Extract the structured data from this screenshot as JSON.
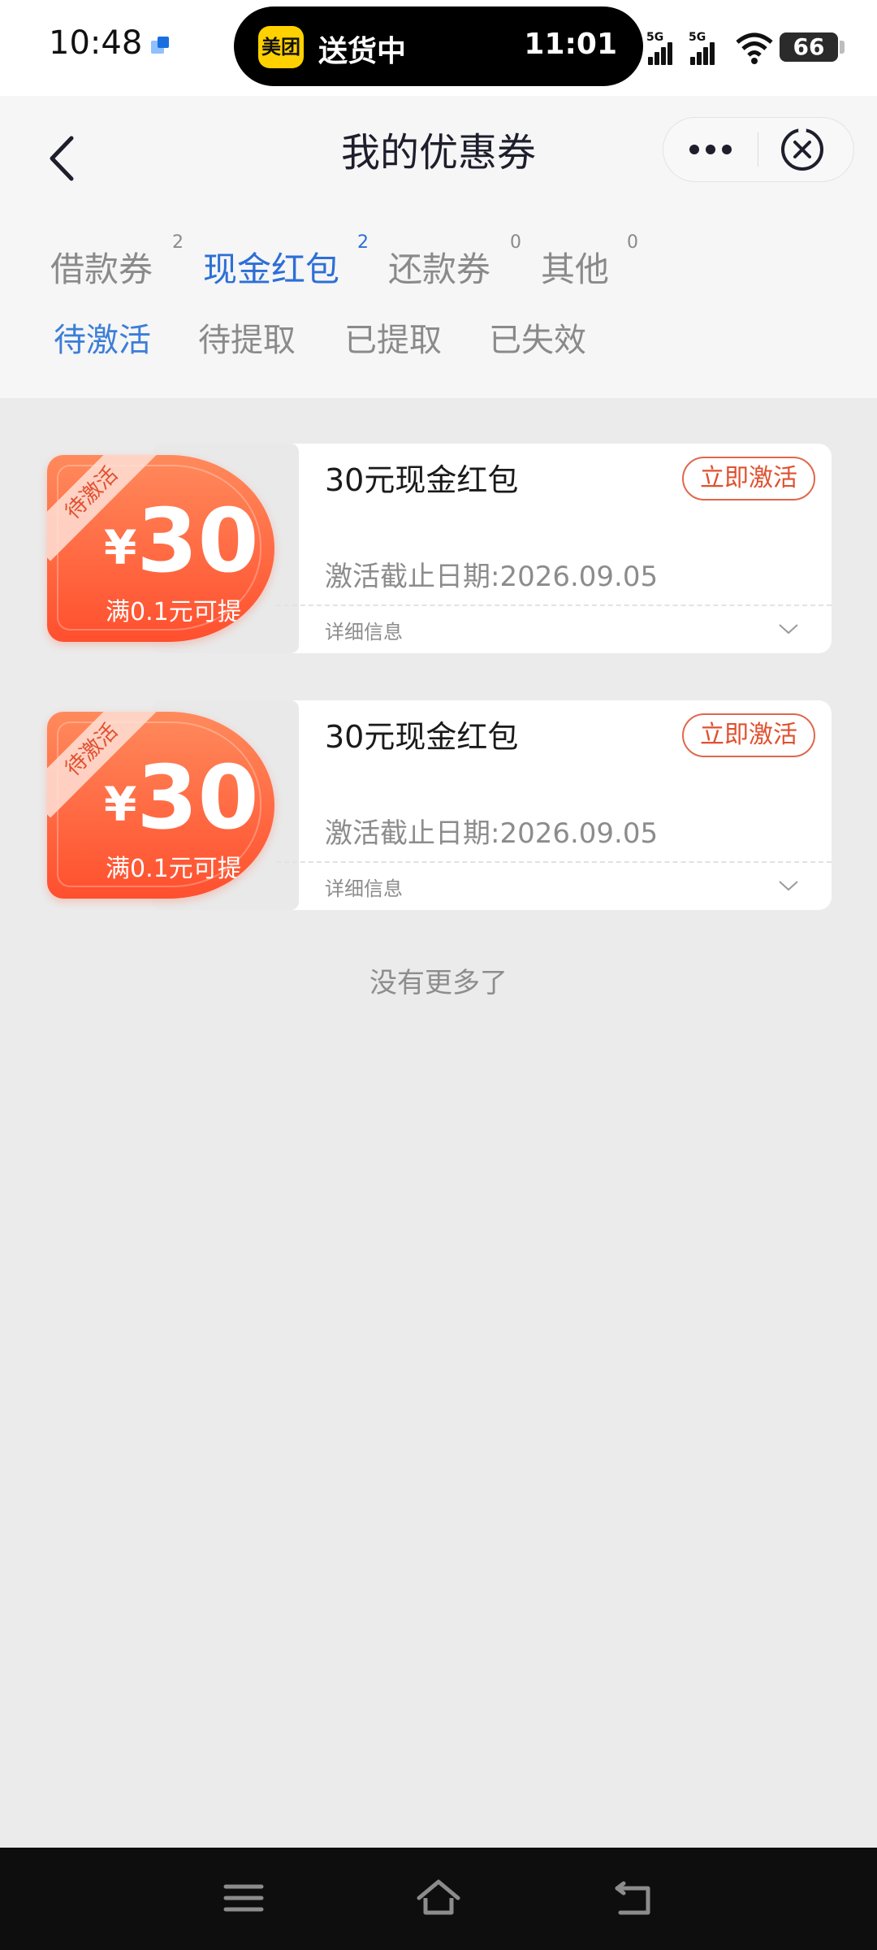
{
  "status_bar": {
    "time": "10:48",
    "island_app": "美团",
    "island_text": "送货中",
    "island_time": "11:01",
    "signal1_label": "5G",
    "signal2_label": "5G",
    "battery": "66",
    "icons": [
      "app-notification-icon",
      "signal-icon",
      "wifi-icon",
      "battery-icon"
    ]
  },
  "header": {
    "title": "我的优惠券",
    "back_icon": "chevron-left-icon",
    "more_icon": "more-dots-icon",
    "close_icon": "close-circle-icon"
  },
  "tabs": [
    {
      "label": "借款券",
      "count": "2",
      "active": false
    },
    {
      "label": "现金红包",
      "count": "2",
      "active": true
    },
    {
      "label": "还款券",
      "count": "0",
      "active": false
    },
    {
      "label": "其他",
      "count": "0",
      "active": false
    }
  ],
  "subtabs": [
    {
      "label": "待激活",
      "active": true
    },
    {
      "label": "待提取",
      "active": false
    },
    {
      "label": "已提取",
      "active": false
    },
    {
      "label": "已失效",
      "active": false
    }
  ],
  "coupons": [
    {
      "ribbon": "待激活",
      "currency": "¥",
      "amount": "30",
      "condition": "满0.1元可提",
      "title": "30元现金红包",
      "button": "立即激活",
      "deadline": "激活截止日期:2026.09.05",
      "detail": "详细信息"
    },
    {
      "ribbon": "待激活",
      "currency": "¥",
      "amount": "30",
      "condition": "满0.1元可提",
      "title": "30元现金红包",
      "button": "立即激活",
      "deadline": "激活截止日期:2026.09.05",
      "detail": "详细信息"
    }
  ],
  "footer_text": "没有更多了",
  "colors": {
    "accent": "#2d6fd6",
    "coupon_red": "#ff4f2e",
    "coupon_orange": "#ff8a5c",
    "background": "#ebebeb"
  }
}
